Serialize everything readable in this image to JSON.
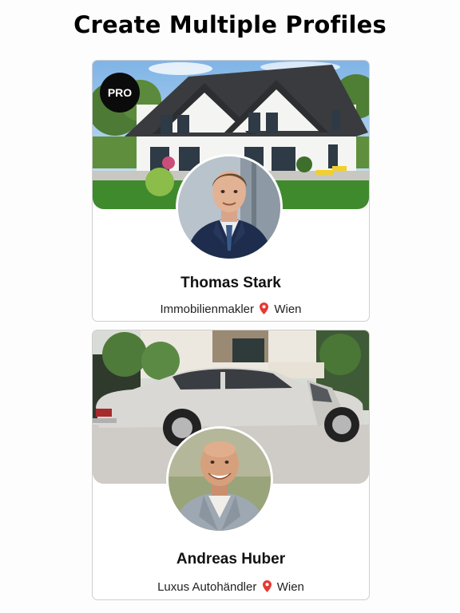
{
  "page": {
    "title": "Create Multiple Profiles"
  },
  "profiles": [
    {
      "name": "Thomas Stark",
      "profession": "Immobilienmakler",
      "location": "Wien",
      "badge": "PRO",
      "cover_icon": "house-cover-image",
      "avatar_icon": "man-in-suit-avatar",
      "location_icon": "location-pin-icon"
    },
    {
      "name": "Andreas Huber",
      "profession": "Luxus Autohändler",
      "location": "Wien",
      "cover_icon": "luxury-car-cover-image",
      "avatar_icon": "smiling-man-avatar",
      "location_icon": "location-pin-icon"
    }
  ],
  "colors": {
    "badge_background": "#0b0b0b",
    "pin": "#e53935",
    "card_border": "#cfcfcf"
  }
}
